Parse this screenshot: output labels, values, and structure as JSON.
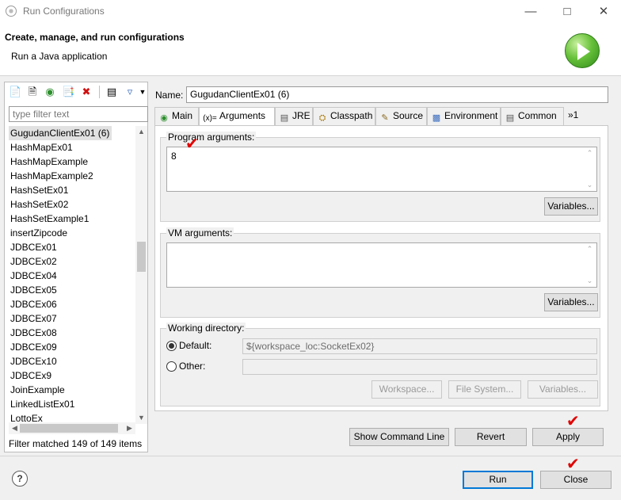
{
  "window": {
    "title": "Run Configurations"
  },
  "header": {
    "title": "Create, manage, and run configurations",
    "subtitle": "Run a Java application"
  },
  "left": {
    "filter_placeholder": "type filter text",
    "items": [
      "GugudanClientEx01 (6)",
      "HashMapEx01",
      "HashMapExample",
      "HashMapExample2",
      "HashSetEx01",
      "HashSetEx02",
      "HashSetExample1",
      "insertZipcode",
      "JDBCEx01",
      "JDBCEx02",
      "JDBCEx04",
      "JDBCEx05",
      "JDBCEx06",
      "JDBCEx07",
      "JDBCEx08",
      "JDBCEx09",
      "JDBCEx10",
      "JDBCEx9",
      "JoinExample",
      "LinkedListEx01",
      "LottoEx"
    ],
    "filter_status": "Filter matched 149 of 149 items"
  },
  "config": {
    "name_label": "Name:",
    "name_value": "GugudanClientEx01 (6)",
    "tabs": [
      "Main",
      "Arguments",
      "JRE",
      "Classpath",
      "Source",
      "Environment",
      "Common"
    ],
    "tab_overflow": "»1",
    "tab_icons": [
      "main-tab-icon",
      "arguments-tab-icon",
      "jre-tab-icon",
      "classpath-tab-icon",
      "source-tab-icon",
      "environment-tab-icon",
      "common-tab-icon"
    ],
    "program_args_label": "Program arguments:",
    "program_args_value": "8",
    "variables_label": "Variables...",
    "vm_args_label": "VM arguments:",
    "vm_args_value": "",
    "working_dir_label": "Working directory:",
    "default_label": "Default:",
    "default_value": "${workspace_loc:SocketEx02}",
    "other_label": "Other:",
    "other_value": "",
    "workspace_btn": "Workspace...",
    "filesystem_btn": "File System...",
    "variables_btn": "Variables..."
  },
  "actions": {
    "show_command_line": "Show Command Line",
    "revert": "Revert",
    "apply": "Apply",
    "run": "Run",
    "close": "Close"
  },
  "colors": {
    "accent": "#0078d7",
    "check_mark": "#e00000",
    "run_badge": "#4caf2a"
  },
  "annotations": {
    "check_mark": "✔"
  }
}
